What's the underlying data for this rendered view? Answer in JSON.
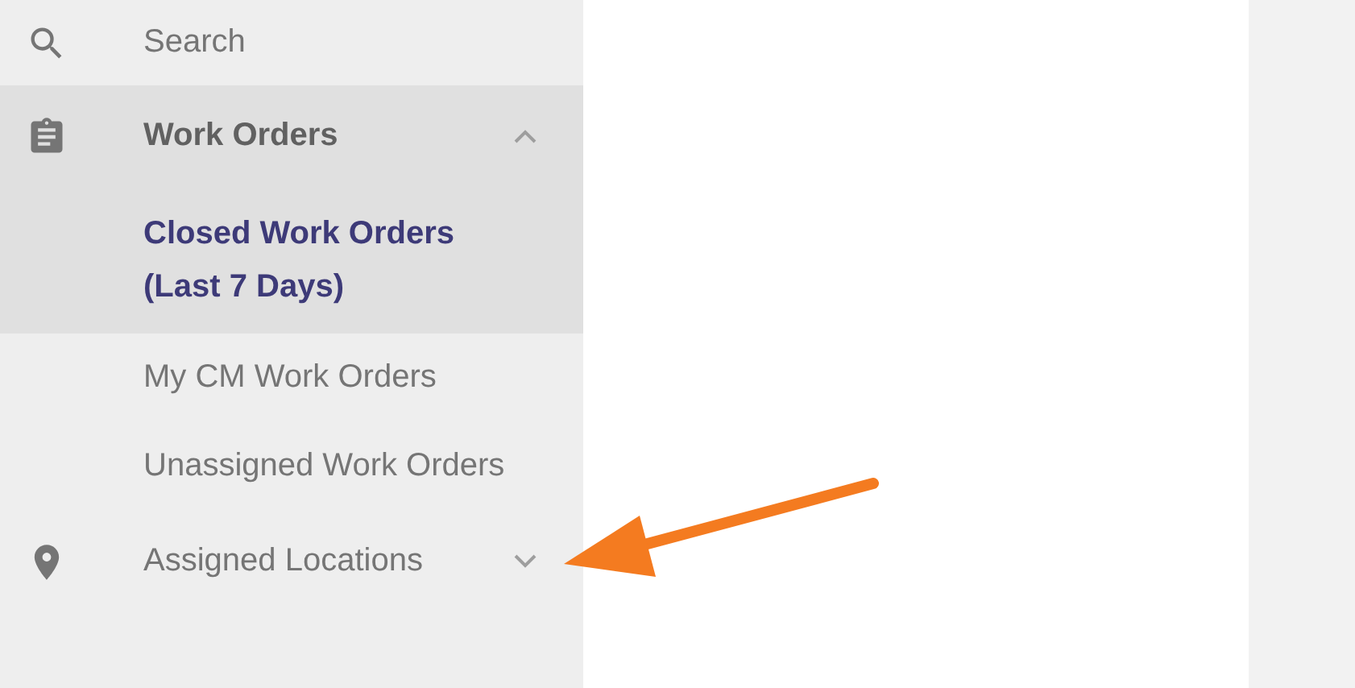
{
  "sidebar": {
    "items": [
      {
        "label": "Search"
      },
      {
        "label": "Work Orders",
        "expanded": true,
        "children": [
          {
            "label": "Closed Work Orders (Last 7 Days)",
            "selected": true
          },
          {
            "label": "My CM Work Orders",
            "selected": false
          },
          {
            "label": "Unassigned Work Orders",
            "selected": false
          }
        ]
      },
      {
        "label": "Assigned Locations",
        "expanded": false
      }
    ]
  }
}
